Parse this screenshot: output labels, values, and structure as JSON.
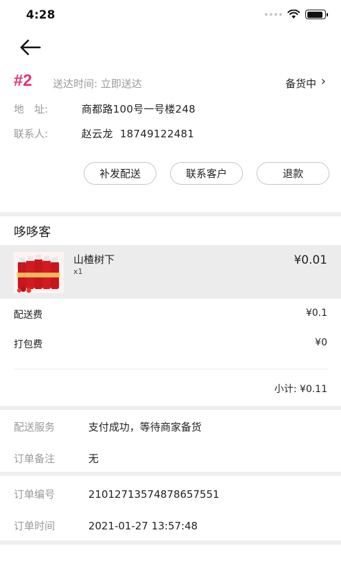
{
  "status_bar": {
    "time": "4:28",
    "battery_level": 0.9
  },
  "nav": {
    "back_icon": "arrow-left-icon"
  },
  "order": {
    "number": "#2",
    "delivery_time": "送达时间: 立即送达",
    "status": "备货中",
    "address_label": "地　址:",
    "address": "商都路100号一号楼248",
    "contact_label": "联系人:",
    "contact": "赵云龙  18749122481"
  },
  "actions": {
    "resend": "补发配送",
    "contact_customer": "联系客户",
    "refund": "退款"
  },
  "shop": {
    "name": "哆哆客",
    "items": [
      {
        "name": "山楂树下",
        "qty": "x1",
        "price": "¥0.01"
      }
    ]
  },
  "fees": {
    "delivery_label": "配送费",
    "delivery_value": "¥0.1",
    "packing_label": "打包费",
    "packing_value": "¥0",
    "subtotal": "小计: ¥0.11"
  },
  "details": {
    "service_label": "配送服务",
    "service_value": "支付成功，等待商家备货",
    "remark_label": "订单备注",
    "remark_value": "无",
    "order_no_label": "订单编号",
    "order_no_value": "21012713574878657551",
    "order_time_label": "订单时间",
    "order_time_value": "2021-01-27 13:57:48"
  },
  "colors": {
    "accent": "#e8336d",
    "muted": "#999999",
    "divider": "#efefef",
    "item_bg": "#ececec"
  }
}
